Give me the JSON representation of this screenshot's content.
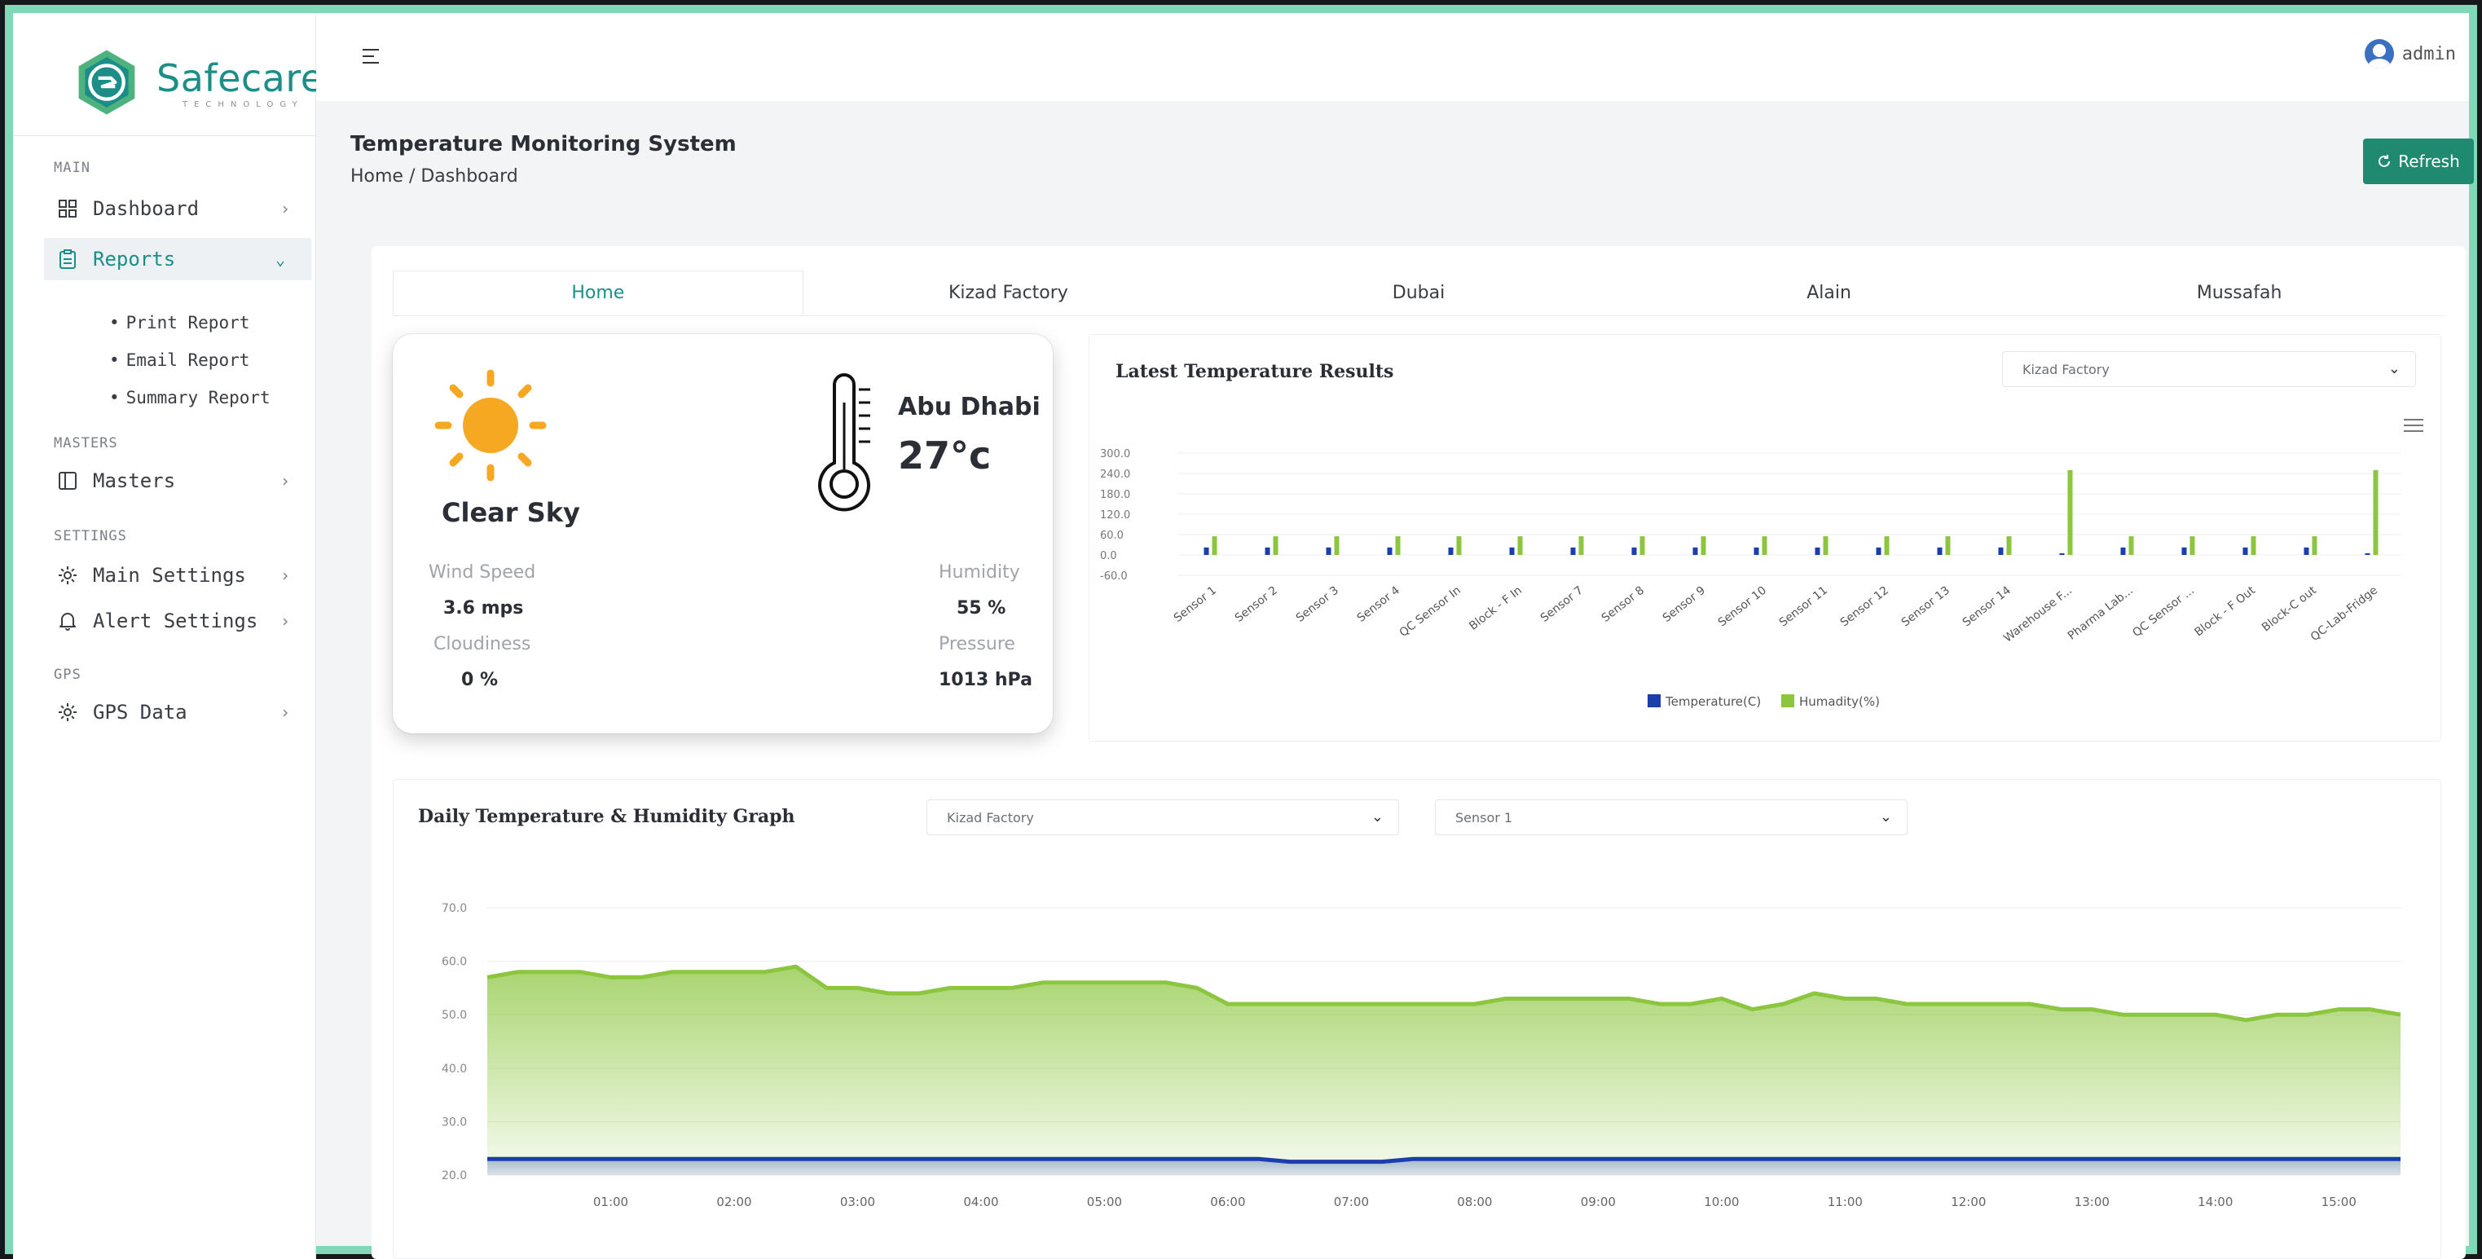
{
  "brand": {
    "name": "Safecare",
    "sub": "TECHNOLOGY"
  },
  "user": {
    "name": "admin"
  },
  "sidebar": {
    "sections": {
      "main": "MAIN",
      "masters": "MASTERS",
      "settings": "SETTINGS",
      "gps": "GPS"
    },
    "items": {
      "dashboard": "Dashboard",
      "reports": "Reports",
      "print_report": "Print Report",
      "email_report": "Email Report",
      "summary_report": "Summary Report",
      "masters": "Masters",
      "main_settings": "Main Settings",
      "alert_settings": "Alert Settings",
      "gps_data": "GPS Data"
    },
    "icons": {
      "dashboard": "grid-icon",
      "reports": "clipboard-icon",
      "masters": "panel-icon",
      "main_settings": "gear-icon",
      "alert_settings": "bell-icon",
      "gps_data": "gear-icon"
    }
  },
  "header": {
    "title": "Temperature Monitoring System",
    "breadcrumb": "Home / Dashboard",
    "refresh_label": "Refresh"
  },
  "tabs": [
    "Home",
    "Kizad Factory",
    "Dubai",
    "Alain",
    "Mussafah"
  ],
  "weather": {
    "description": "Clear Sky",
    "city": "Abu Dhabi",
    "temperature": "27°c",
    "wind_label": "Wind Speed",
    "wind_value": "3.6 mps",
    "humidity_label": "Humidity",
    "humidity_value": "55 %",
    "cloud_label": "Cloudiness",
    "cloud_value": "0 %",
    "pressure_label": "Pressure",
    "pressure_value": "1013 hPa"
  },
  "latest": {
    "title": "Latest Temperature Results",
    "site_select": "Kizad Factory"
  },
  "daily": {
    "title": "Daily Temperature & Humidity Graph",
    "site_select": "Kizad Factory",
    "sensor_select": "Sensor 1"
  },
  "colors": {
    "temperature": "#1a3faa",
    "humidity": "#8cc63f",
    "accent": "#1b8f87",
    "refresh": "#1f8a6f"
  },
  "chart_data": [
    {
      "type": "bar",
      "title": "Latest Temperature Results",
      "categories": [
        "Sensor 1",
        "Sensor 2",
        "Sensor 3",
        "Sensor 4",
        "QC Sensor In",
        "Block - F In",
        "Sensor 7",
        "Sensor 8",
        "Sensor 9",
        "Sensor 10",
        "Sensor 11",
        "Sensor 12",
        "Sensor 13",
        "Sensor 14",
        "Warehouse F...",
        "Pharma Lab...",
        "QC Sensor ...",
        "Block - F Out",
        "Block-C out",
        "QC-Lab-Fridge"
      ],
      "series": [
        {
          "name": "Temperature(C)",
          "values": [
            22,
            22,
            22,
            22,
            22,
            22,
            22,
            22,
            22,
            22,
            22,
            22,
            22,
            22,
            5,
            22,
            22,
            22,
            22,
            5
          ]
        },
        {
          "name": "Humadity(%)",
          "values": [
            55,
            55,
            55,
            55,
            55,
            55,
            55,
            55,
            55,
            55,
            55,
            55,
            55,
            55,
            250,
            55,
            55,
            55,
            55,
            250
          ]
        }
      ],
      "yticks": [
        "300.0",
        "240.0",
        "180.0",
        "120.0",
        "60.0",
        "0.0",
        "-60.0"
      ],
      "ylim": [
        -60,
        300
      ],
      "legend": "bottom"
    },
    {
      "type": "area",
      "title": "Daily Temperature & Humidity Graph",
      "x": [
        "00:00",
        "00:15",
        "00:30",
        "00:45",
        "01:00",
        "01:15",
        "01:30",
        "01:45",
        "02:00",
        "02:15",
        "02:30",
        "02:45",
        "03:00",
        "03:15",
        "03:30",
        "03:45",
        "04:00",
        "04:15",
        "04:30",
        "04:45",
        "05:00",
        "05:15",
        "05:30",
        "05:45",
        "06:00",
        "06:15",
        "06:30",
        "06:45",
        "07:00",
        "07:15",
        "07:30",
        "07:45",
        "08:00",
        "08:15",
        "08:30",
        "08:45",
        "09:00",
        "09:15",
        "09:30",
        "09:45",
        "10:00",
        "10:15",
        "10:30",
        "10:45",
        "11:00",
        "11:15",
        "11:30",
        "11:45",
        "12:00",
        "12:15",
        "12:30",
        "12:45",
        "13:00",
        "13:15",
        "13:30",
        "13:45",
        "14:00",
        "14:15",
        "14:30",
        "14:45",
        "15:00",
        "15:15",
        "15:30"
      ],
      "series": [
        {
          "name": "",
          "values": [
            57,
            58,
            58,
            58,
            57,
            57,
            58,
            58,
            58,
            58,
            59,
            55,
            55,
            54,
            54,
            55,
            55,
            55,
            56,
            56,
            56,
            56,
            56,
            55,
            52,
            52,
            52,
            52,
            52,
            52,
            52,
            52,
            52,
            53,
            53,
            53,
            53,
            53,
            52,
            52,
            53,
            51,
            52,
            54,
            53,
            53,
            52,
            52,
            52,
            52,
            52,
            51,
            51,
            50,
            50,
            50,
            50,
            49,
            50,
            50,
            51,
            51,
            50
          ]
        },
        {
          "name": "",
          "values": [
            23,
            23,
            23,
            23,
            23,
            23,
            23,
            23,
            23,
            23,
            23,
            23,
            23,
            23,
            23,
            23,
            23,
            23,
            23,
            23,
            23,
            23,
            23,
            23,
            23,
            23,
            22.5,
            22.5,
            22.5,
            22.5,
            23,
            23,
            23,
            23,
            23,
            23,
            23,
            23,
            23,
            23,
            23,
            23,
            23,
            23,
            23,
            23,
            23,
            23,
            23,
            23,
            23,
            23,
            23,
            23,
            23,
            23,
            23,
            23,
            23,
            23,
            23,
            23,
            23
          ]
        }
      ],
      "xticks": [
        "01:00",
        "02:00",
        "03:00",
        "04:00",
        "05:00",
        "06:00",
        "07:00",
        "08:00",
        "09:00",
        "10:00",
        "11:00",
        "12:00",
        "13:00",
        "14:00",
        "15:00"
      ],
      "yticks": [
        "70.0",
        "60.0",
        "50.0",
        "40.0",
        "30.0",
        "20.0"
      ],
      "ylim": [
        20,
        70
      ]
    }
  ]
}
